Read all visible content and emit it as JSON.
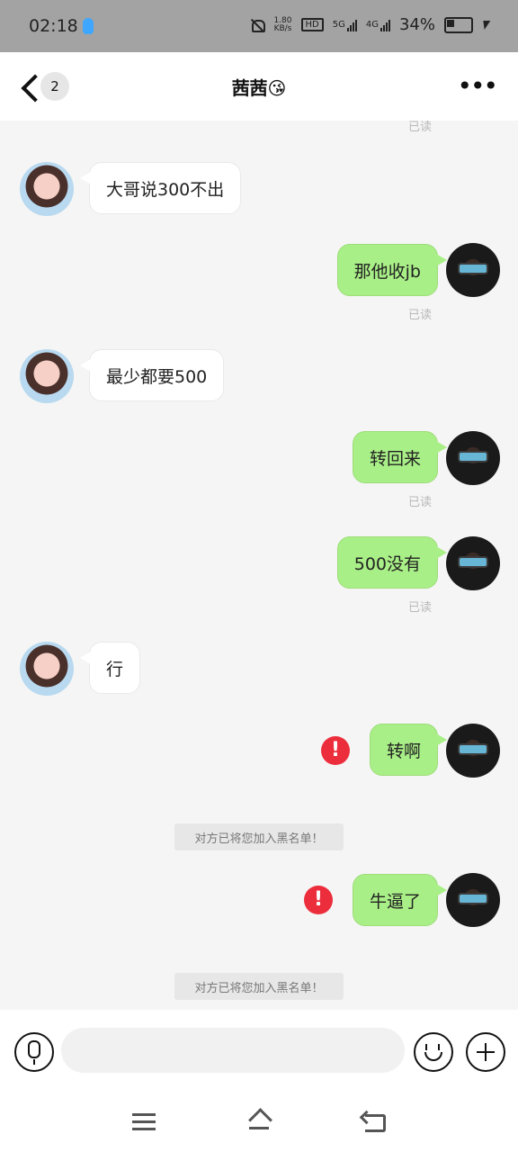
{
  "status_bar": {
    "time": "02:18",
    "net_speed_top": "1.80",
    "net_speed_bottom": "KB/s",
    "hd": "HD",
    "hd_sub": "1",
    "hd_sub2": "2",
    "network_1": "5G",
    "network_2": "4G",
    "battery": "34%"
  },
  "header": {
    "back_count": "2",
    "title": "茜茜😘"
  },
  "messages": [
    {
      "from": "them",
      "text": "大哥说300不出"
    },
    {
      "from": "me",
      "text": "那他收jb",
      "status": "已读"
    },
    {
      "from": "them",
      "text": "最少都要500"
    },
    {
      "from": "me",
      "text": "转回来",
      "status": "已读"
    },
    {
      "from": "me",
      "text": "500没有",
      "status": "已读"
    },
    {
      "from": "them",
      "text": "行"
    },
    {
      "from": "me",
      "text": "转啊",
      "error": true
    },
    {
      "from": "system",
      "text": "对方已将您加入黑名单！"
    },
    {
      "from": "me",
      "text": "牛逼了",
      "error": true
    },
    {
      "from": "system",
      "text": "对方已将您加入黑名单！"
    }
  ],
  "top_read": "已读",
  "colors": {
    "sent_bubble": "#a9ef87",
    "error": "#ec2d3c"
  },
  "icons": {
    "error": "!",
    "more": "•••"
  }
}
